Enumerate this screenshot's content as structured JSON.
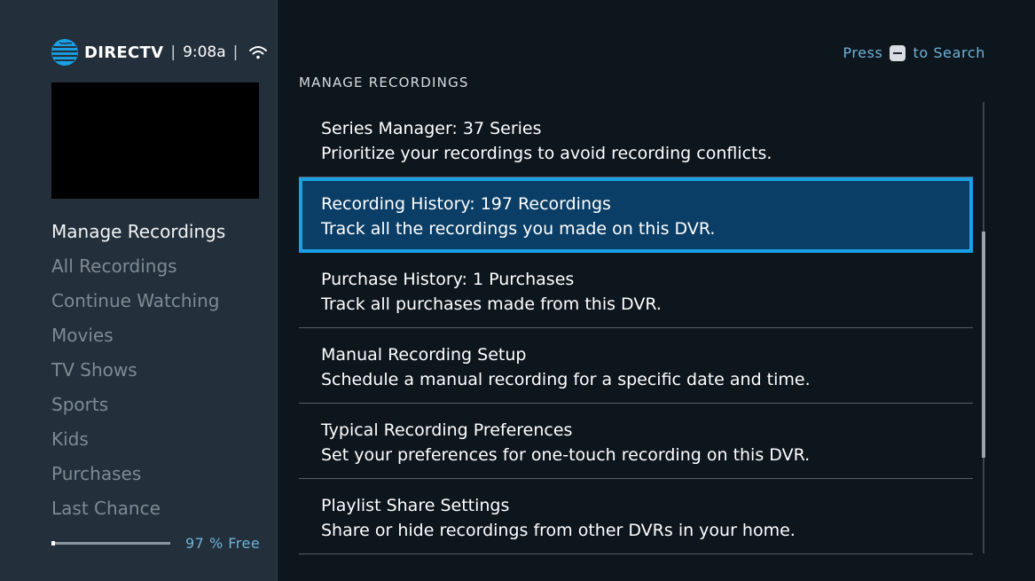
{
  "header": {
    "brand": "DIRECTV",
    "time": "9:08a",
    "separator": "|",
    "search_hint_prefix": "Press",
    "search_hint_suffix": "to Search"
  },
  "sidebar": {
    "nav_items": [
      {
        "label": "Manage Recordings",
        "active": true
      },
      {
        "label": "All Recordings"
      },
      {
        "label": "Continue Watching"
      },
      {
        "label": "Movies"
      },
      {
        "label": "TV Shows"
      },
      {
        "label": "Sports"
      },
      {
        "label": "Kids"
      },
      {
        "label": "Purchases"
      },
      {
        "label": "Last Chance"
      }
    ],
    "storage": {
      "text": "97 % Free",
      "used_fraction": 0.03
    }
  },
  "main": {
    "section_title": "MANAGE RECORDINGS",
    "items": [
      {
        "title": "Series Manager: 37 Series",
        "desc": "Prioritize your recordings to avoid recording conflicts."
      },
      {
        "title": "Recording History: 197 Recordings",
        "desc": "Track all the recordings you made on this DVR.",
        "selected": true
      },
      {
        "title": "Purchase History: 1 Purchases",
        "desc": "Track all purchases made from this DVR."
      },
      {
        "title": "Manual Recording Setup",
        "desc": "Schedule a manual recording for a specific date and time."
      },
      {
        "title": "Typical Recording Preferences",
        "desc": "Set your preferences for one-touch recording on this DVR."
      },
      {
        "title": "Playlist Share Settings",
        "desc": "Share or hide recordings from other DVRs in your home."
      }
    ]
  },
  "colors": {
    "accent": "#1aa0e6",
    "selected_bg": "#0b3e66",
    "hint_text": "#6fb3d8"
  },
  "icons": {
    "brand": "att-globe-icon",
    "wifi": "wifi-icon",
    "search_key": "minus-key-icon"
  }
}
